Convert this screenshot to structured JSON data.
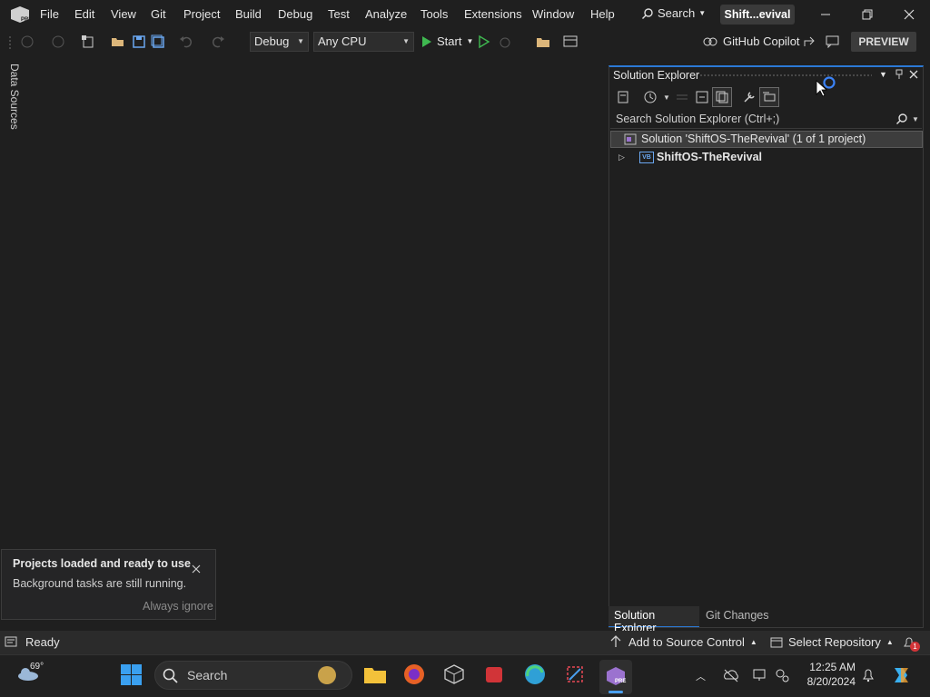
{
  "menu": {
    "items": [
      "File",
      "Edit",
      "View",
      "Git",
      "Project",
      "Build",
      "Debug",
      "Test",
      "Analyze",
      "Tools",
      "Extensions",
      "Window",
      "Help"
    ],
    "search_label": "Search",
    "title": "Shift...evival"
  },
  "toolbar": {
    "config": "Debug",
    "platform": "Any CPU",
    "start_label": "Start",
    "copilot_label": "GitHub Copilot",
    "preview_label": "PREVIEW"
  },
  "left": {
    "data_sources_label": "Data Sources"
  },
  "solution_explorer": {
    "title": "Solution Explorer",
    "search_placeholder": "Search Solution Explorer (Ctrl+;)",
    "solution_label": "Solution 'ShiftOS-TheRevival' (1 of 1 project)",
    "project_label": "ShiftOS-TheRevival",
    "project_badge": "VB",
    "tabs": [
      "Solution Explorer",
      "Git Changes"
    ]
  },
  "notification": {
    "title": "Projects loaded and ready to use",
    "body": "Background tasks are still running.",
    "link": "Always ignore"
  },
  "statusbar": {
    "ready": "Ready",
    "source_control": "Add to Source Control",
    "repository": "Select Repository",
    "notif_count": "1"
  },
  "taskbar": {
    "temperature": "69°",
    "search_label": "Search",
    "time": "12:25 AM",
    "date": "8/20/2024"
  },
  "colors": {
    "accent": "#2b79d6",
    "vs_purple": "#9b72cf",
    "panel_bg": "#1f1f1f"
  }
}
